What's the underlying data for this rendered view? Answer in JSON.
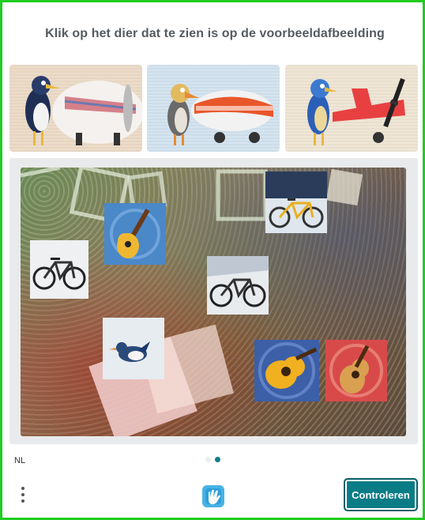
{
  "title": "Klik op het dier dat te zien is op de voorbeeldafbeelding",
  "examples": [
    {
      "name": "example-image-bird-airplane-1",
      "icon": "bird-plane-icon"
    },
    {
      "name": "example-image-bird-airplane-2",
      "icon": "bird-plane-icon"
    },
    {
      "name": "example-image-bird-airplane-3",
      "icon": "bird-plane-icon"
    }
  ],
  "board": {
    "tiles": [
      {
        "name": "tile-guitar-1",
        "icon": "guitar-icon"
      },
      {
        "name": "tile-bicycle-1",
        "icon": "bicycle-icon"
      },
      {
        "name": "tile-bicycle-2",
        "icon": "bicycle-icon"
      },
      {
        "name": "tile-bicycle-3",
        "icon": "bicycle-icon"
      },
      {
        "name": "tile-bird",
        "icon": "bird-icon"
      },
      {
        "name": "tile-guitar-2",
        "icon": "guitar-icon"
      },
      {
        "name": "tile-guitar-3",
        "icon": "guitar-icon"
      }
    ]
  },
  "footer": {
    "language": "NL",
    "page_indicator": {
      "current": 2,
      "total": 2
    },
    "menu_icon": "more-vertical-icon",
    "logo_icon": "hand-logo-icon",
    "submit_label": "Controleren"
  },
  "colors": {
    "accent": "#0a7c86",
    "frame": "#22cc22",
    "title": "#555b60"
  }
}
